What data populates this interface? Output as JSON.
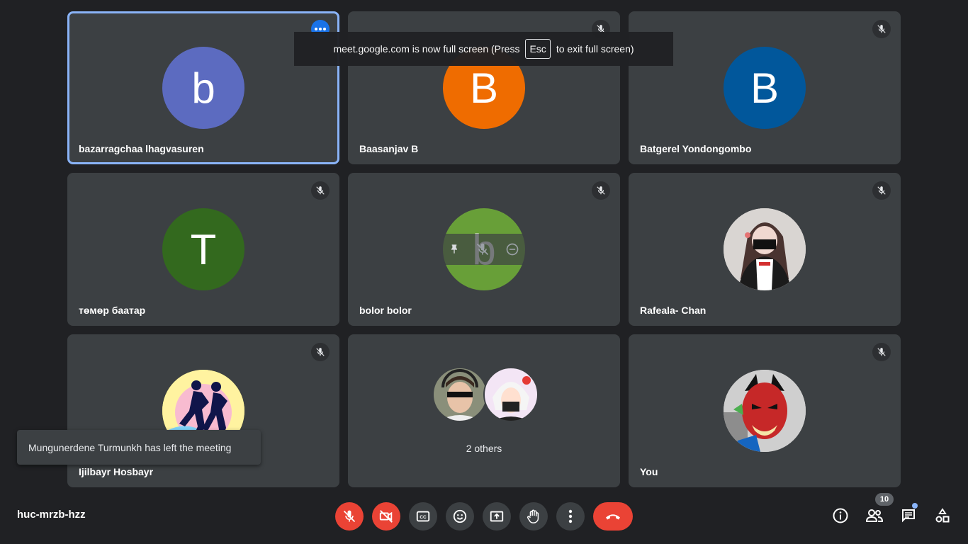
{
  "banner": {
    "text_before": "meet.google.com is now full screen (Press",
    "key": "Esc",
    "text_after": "to exit full screen)"
  },
  "tiles": [
    {
      "name": "bazarragchaa lhagvasuren",
      "initial": "b",
      "color": "#5c6bc0"
    },
    {
      "name": "Baasanjav B",
      "initial": "B",
      "color": "#ef6c00"
    },
    {
      "name": "Batgerel Yondongombo",
      "initial": "B",
      "color": "#01579b"
    },
    {
      "name": "төмөр баатар",
      "initial": "T",
      "color": "#33691e"
    },
    {
      "name": "bolor bolor",
      "initial": "b",
      "color": "#689f38"
    },
    {
      "name": "Rafeala- Chan",
      "initial": "",
      "color": "#aaaaaa"
    },
    {
      "name": "Ijilbayr Hosbayr",
      "initial": "",
      "color": "#fce84b"
    },
    {
      "name": "",
      "initial": "",
      "color": ""
    },
    {
      "name": "You",
      "initial": "",
      "color": "#c62828"
    }
  ],
  "others_label": "2 others",
  "toast": "Mungunerdene Turmunkh has left the meeting",
  "meeting_code": "huc-mrzb-hzz",
  "participants_count": "10",
  "icons": {
    "mic_off": "mic-off-icon",
    "cam_off": "camera-off-icon",
    "captions": "captions-icon",
    "emoji": "emoji-icon",
    "present": "present-screen-icon",
    "raise_hand": "raise-hand-icon",
    "more": "more-options-icon",
    "end_call": "end-call-icon",
    "info": "info-icon",
    "people": "people-icon",
    "chat": "chat-icon",
    "activities": "activities-icon",
    "pin": "pin-icon",
    "remove": "remove-icon"
  }
}
